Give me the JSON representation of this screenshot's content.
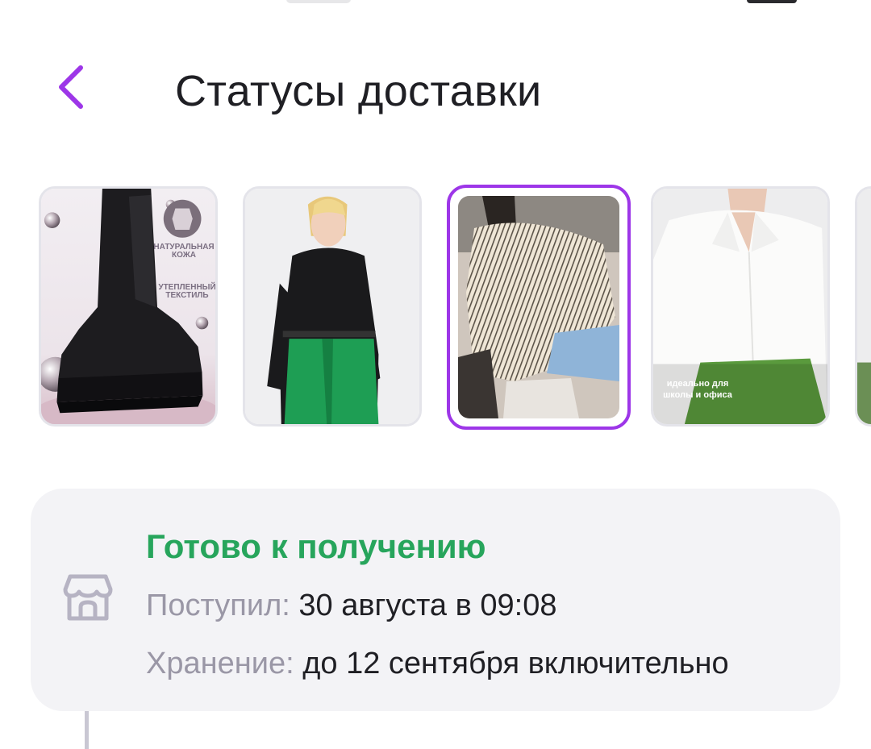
{
  "header": {
    "title": "Статусы доставки"
  },
  "products": [
    {
      "type": "boots",
      "tags": [
        "Натуральная кожа",
        "Утепленный текстиль"
      ],
      "selected": false
    },
    {
      "type": "black-shirt",
      "selected": false
    },
    {
      "type": "striped-sweater",
      "selected": true
    },
    {
      "type": "white-blouse",
      "caption": "идеально для школы и офиса",
      "selected": false
    },
    {
      "type": "partial",
      "selected": false
    }
  ],
  "status": {
    "title": "Готово к получению",
    "received_label": "Поступил:",
    "received_value": "30 августа в 09:08",
    "storage_label": "Хранение:",
    "storage_value": "до 12 сентября включительно"
  },
  "colors": {
    "accent": "#9d36e8",
    "status": "#27a55c",
    "muted": "#9a97a6",
    "card": "#f3f3f6"
  },
  "icons": {
    "back": "chevron-left-icon",
    "store": "store-icon"
  }
}
